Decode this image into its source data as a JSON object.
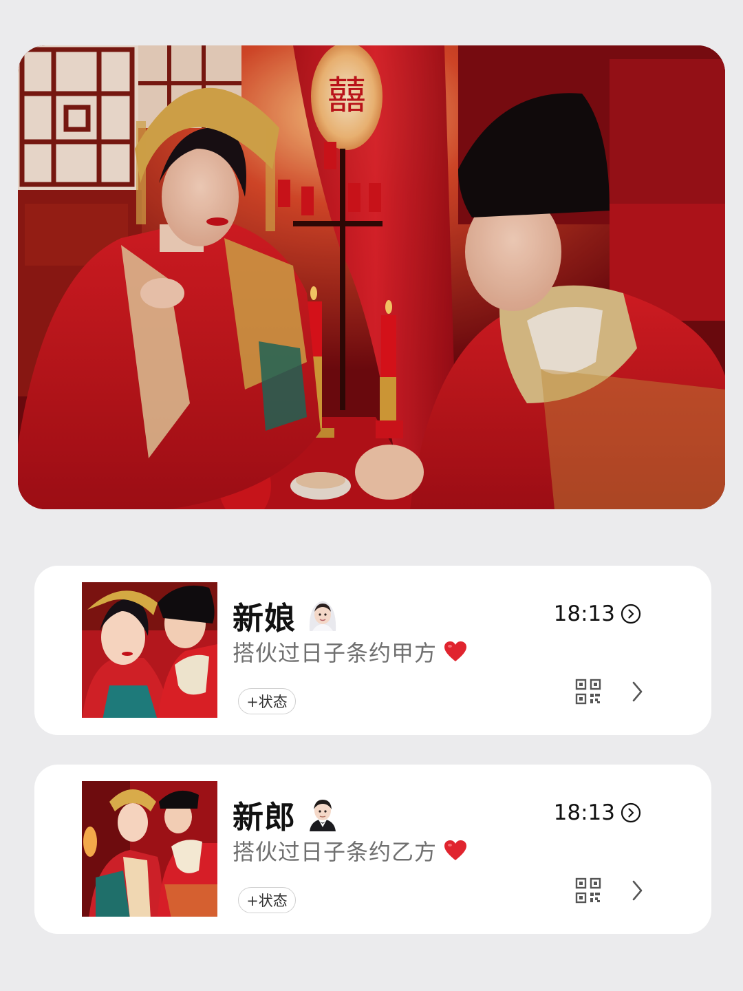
{
  "hero": {
    "icon": "wedding-photo",
    "lantern_char": "囍"
  },
  "profiles": [
    {
      "name": "新娘",
      "name_emoji": "bride-with-veil-icon",
      "subtitle": "搭伙过日子条约甲方",
      "subtitle_emoji": "red-heart-icon",
      "status_button": "+状态",
      "time": "18:13"
    },
    {
      "name": "新郎",
      "name_emoji": "groom-in-tuxedo-icon",
      "subtitle": "搭伙过日子条约乙方",
      "subtitle_emoji": "red-heart-icon",
      "status_button": "+状态",
      "time": "18:13"
    }
  ],
  "colors": {
    "background": "#ebebed",
    "card": "#ffffff",
    "accent_red": "#c8101c",
    "gold": "#d4a53c"
  }
}
